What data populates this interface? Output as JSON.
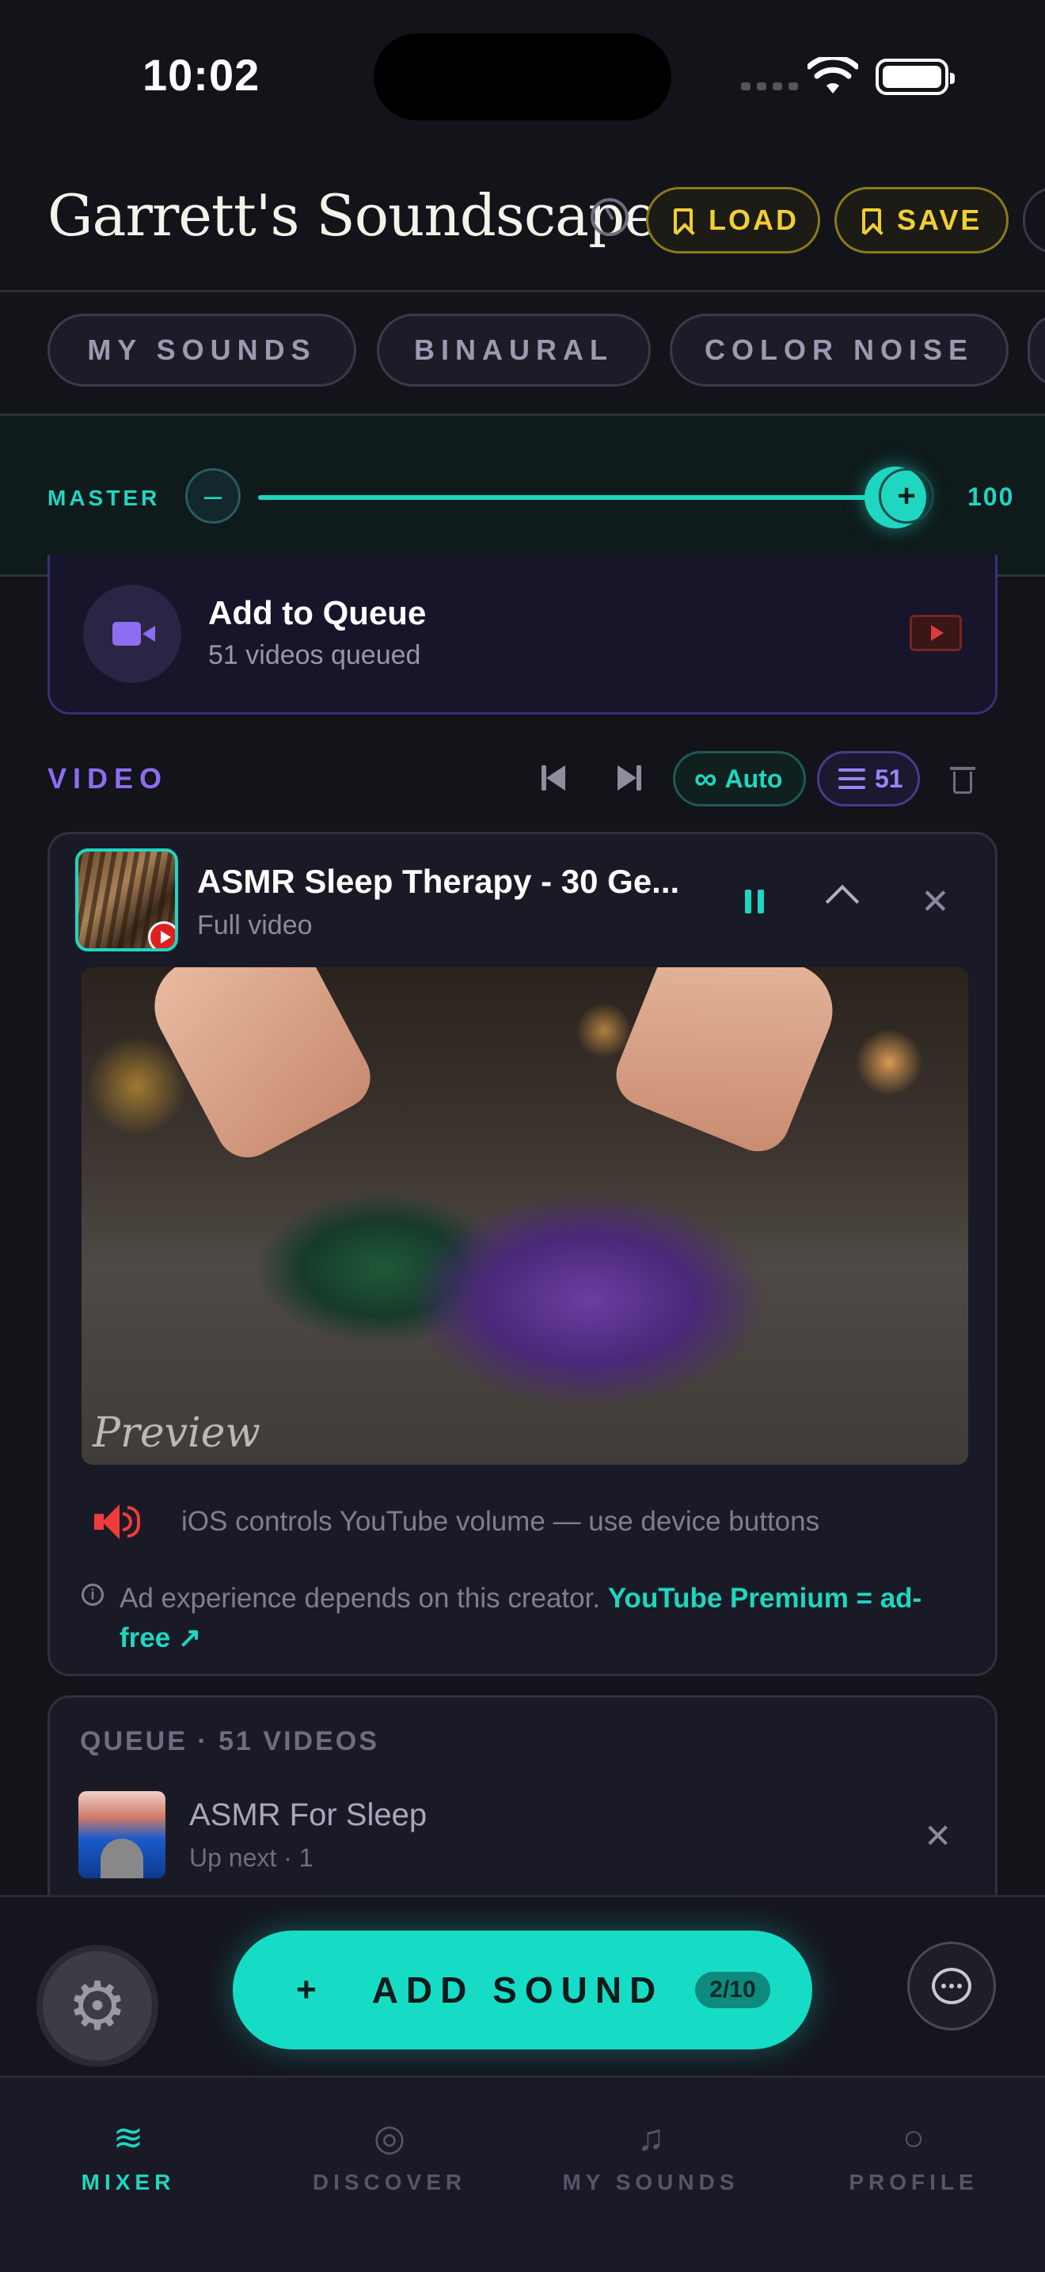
{
  "status_bar": {
    "time": "10:02"
  },
  "header": {
    "title": "Garrett's Soundscape",
    "load_label": "LOAD",
    "save_label": "SAVE"
  },
  "tabs": [
    {
      "label": "MY SOUNDS"
    },
    {
      "label": "BINAURAL"
    },
    {
      "label": "COLOR NOISE"
    }
  ],
  "master": {
    "label": "MASTER",
    "minus": "–",
    "plus": "+",
    "value": "100",
    "level": 1.0
  },
  "add_queue": {
    "title": "Add to Queue",
    "subtitle": "51 videos queued"
  },
  "video_section": {
    "label": "VIDEO",
    "auto_label": "Auto",
    "queue_count": "51"
  },
  "now_playing": {
    "title": "ASMR Sleep Therapy - 30 Ge...",
    "subtitle": "Full video",
    "preview_label": "Preview",
    "volume_note": "iOS controls YouTube volume — use device buttons",
    "ad_note": "Ad experience depends on this creator.",
    "ad_link": "YouTube Premium = ad-free ↗"
  },
  "queue": {
    "heading": "QUEUE · 51 VIDEOS",
    "items": [
      {
        "title": "ASMR For Sleep",
        "subtitle": "Up next · 1"
      }
    ]
  },
  "action_bar": {
    "add_plus": "+",
    "add_label": "ADD SOUND",
    "add_count": "2/10"
  },
  "nav": [
    {
      "label": "MIXER",
      "icon": "waves-icon",
      "glyph": "≋",
      "active": true
    },
    {
      "label": "DISCOVER",
      "icon": "discover-icon",
      "glyph": "◎",
      "active": false
    },
    {
      "label": "MY SOUNDS",
      "icon": "music-note-icon",
      "glyph": "♫",
      "active": false
    },
    {
      "label": "PROFILE",
      "icon": "profile-icon",
      "glyph": "○",
      "active": false
    }
  ],
  "colors": {
    "accent": "#1fd6c0",
    "video_purple": "#8d6df2",
    "save_gold": "#f0cf33",
    "background": "#13131a"
  }
}
